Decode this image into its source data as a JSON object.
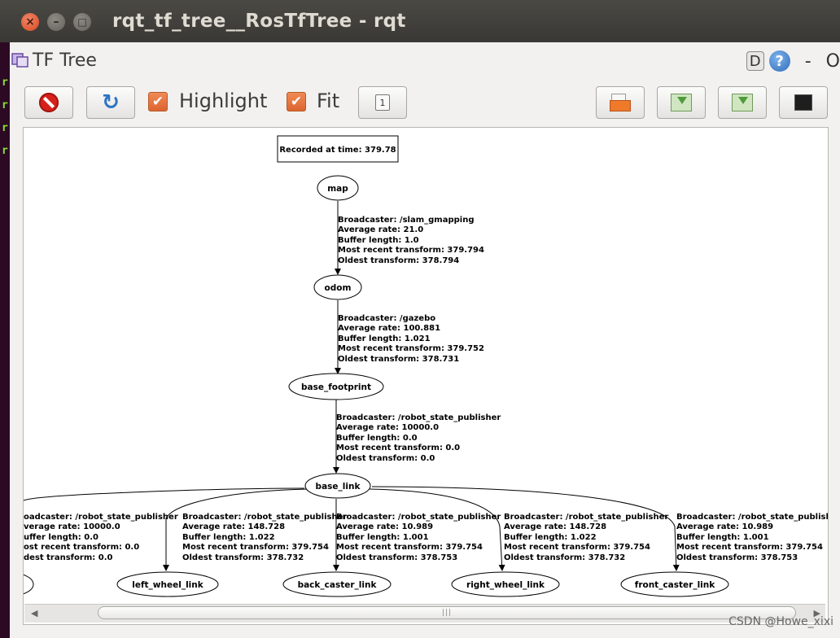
{
  "window": {
    "title": "rqt_tf_tree__RosTfTree - rqt"
  },
  "terminal": {
    "prompts": [
      "r",
      "r",
      "r",
      "r"
    ]
  },
  "plugin": {
    "title": "TF Tree",
    "d_label": "D",
    "help_label": "?",
    "dash_label": "-",
    "o_label": "O"
  },
  "toolbar": {
    "highlight_label": "Highlight",
    "highlight_checked": true,
    "fit_label": "Fit",
    "fit_checked": true,
    "check_glyph": "✔",
    "one_label": "1"
  },
  "graph": {
    "recorded": "Recorded at time: 379.78",
    "nodes": {
      "map": "map",
      "odom": "odom",
      "base_footprint": "base_footprint",
      "base_link": "base_link",
      "left_wheel_link": "left_wheel_link",
      "back_caster_link": "back_caster_link",
      "right_wheel_link": "right_wheel_link",
      "front_caster_link": "front_caster_link"
    },
    "edges": {
      "map_odom": [
        "Broadcaster: /slam_gmapping",
        "Average rate: 21.0",
        "Buffer length: 1.0",
        "Most recent transform: 379.794",
        "Oldest transform: 378.794"
      ],
      "odom_footprint": [
        "Broadcaster: /gazebo",
        "Average rate: 100.881",
        "Buffer length: 1.021",
        "Most recent transform: 379.752",
        "Oldest transform: 378.731"
      ],
      "footprint_base": [
        "Broadcaster: /robot_state_publisher",
        "Average rate: 10000.0",
        "Buffer length: 0.0",
        "Most recent transform: 0.0",
        "Oldest transform: 0.0"
      ],
      "base_hidden": [
        "oadcaster: /robot_state_publisher",
        "verage rate: 10000.0",
        "uffer length: 0.0",
        "ost recent transform: 0.0",
        "dest transform: 0.0"
      ],
      "base_left": [
        "Broadcaster: /robot_state_publisher",
        "Average rate: 148.728",
        "Buffer length: 1.022",
        "Most recent transform: 379.754",
        "Oldest transform: 378.732"
      ],
      "base_back": [
        "Broadcaster: /robot_state_publisher",
        "Average rate: 10.989",
        "Buffer length: 1.001",
        "Most recent transform: 379.754",
        "Oldest transform: 378.753"
      ],
      "base_right": [
        "Broadcaster: /robot_state_publisher",
        "Average rate: 148.728",
        "Buffer length: 1.022",
        "Most recent transform: 379.754",
        "Oldest transform: 378.732"
      ],
      "base_front": [
        "Broadcaster: /robot_state_publisher",
        "Average rate: 10.989",
        "Buffer length: 1.001",
        "Most recent transform: 379.754",
        "Oldest transform: 378.753"
      ]
    }
  },
  "scrollbar": {
    "left_arrow": "◀",
    "right_arrow": "▶",
    "grip": "|||"
  },
  "watermark": "CSDN @Howe_xixi"
}
